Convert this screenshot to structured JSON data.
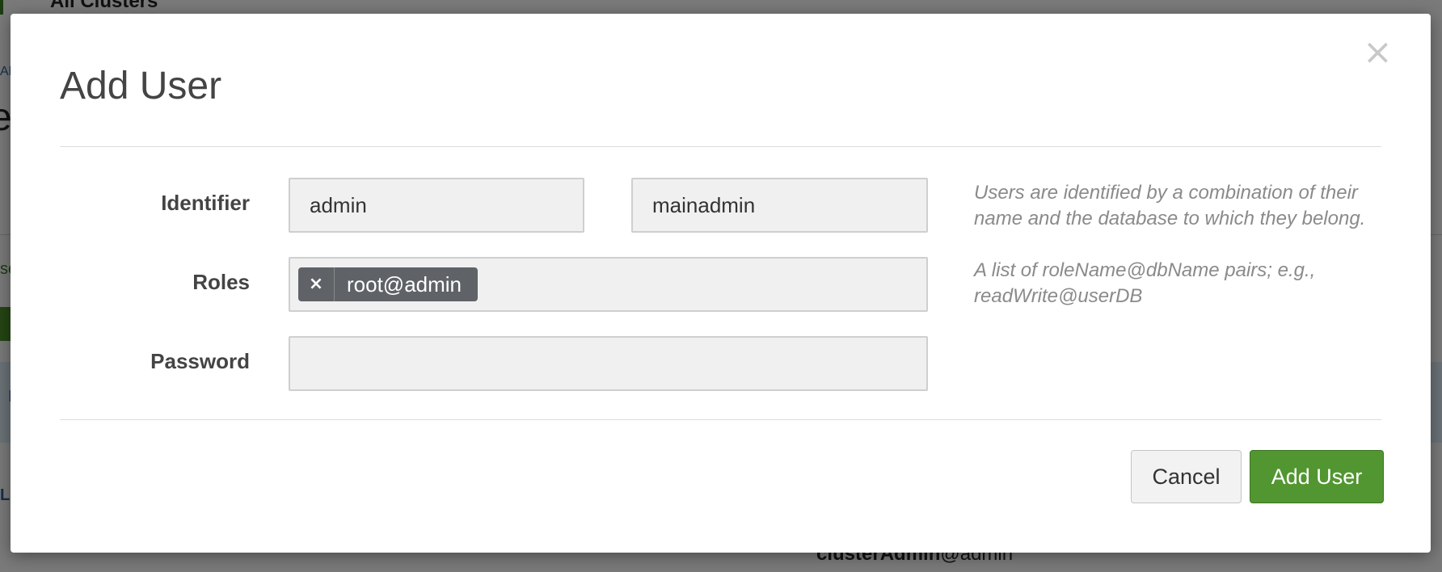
{
  "background": {
    "breadcrumb": "All Clusters",
    "fragment_a": "AN",
    "fragment_e": "e",
    "fragment_se": "se",
    "fragment_l": "L",
    "fragment_i": "I",
    "cluster_user_name": "clusterAdmin",
    "cluster_user_db": "@admin"
  },
  "modal": {
    "title": "Add User",
    "close_icon": "close-icon",
    "identifier": {
      "label": "Identifier",
      "database_value": "admin",
      "username_value": "mainadmin",
      "help": "Users are identified by a combination of their name and the database to which they belong."
    },
    "roles": {
      "label": "Roles",
      "tags": [
        {
          "label": "root@admin",
          "remove_glyph": "×"
        }
      ],
      "help": "A list of roleName@dbName pairs; e.g., readWrite@userDB"
    },
    "password": {
      "label": "Password",
      "value": ""
    },
    "buttons": {
      "cancel": "Cancel",
      "submit": "Add User"
    }
  },
  "colors": {
    "primary_button": "#529632",
    "tag_background": "#5f6368",
    "overlay": "rgba(0,0,0,0.5)"
  }
}
